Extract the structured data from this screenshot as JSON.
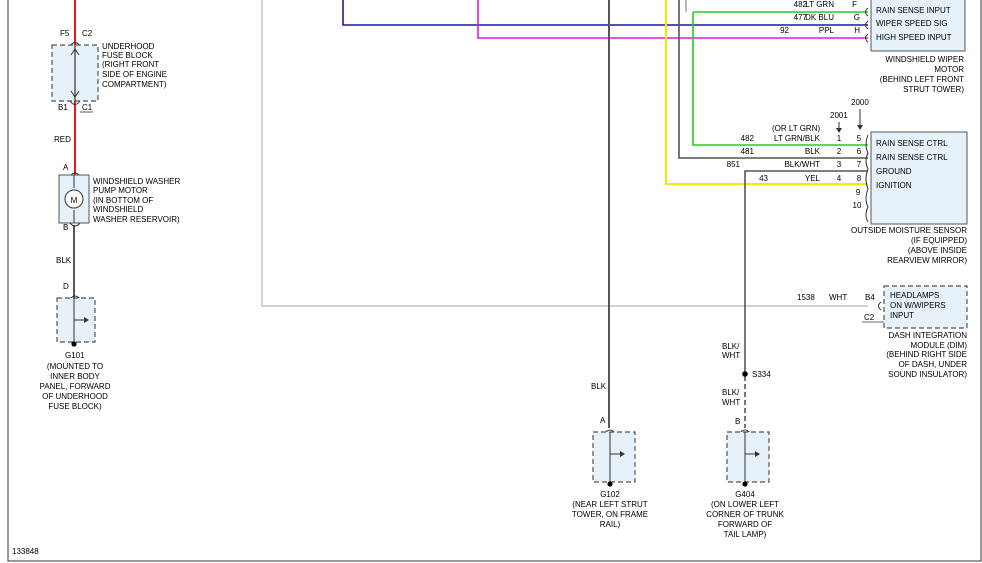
{
  "colors": {
    "red": "#e01a1a",
    "blk": "#555555",
    "ltgrn": "#8a8a8a",
    "dkblu": "#1a1a99",
    "ppl": "#e01ad0",
    "grn": "#22cc22",
    "yel": "#eded00",
    "tan": "#b8b8b8",
    "box_fill": "#e6f1fa"
  },
  "fuse_block": {
    "f5": "F5",
    "c2": "C2",
    "b1": "B1",
    "c1": "C1",
    "label": [
      "UNDERHOOD",
      "FUSE BLOCK",
      "(RIGHT FRONT",
      "SIDE OF ENGINE",
      "COMPARTMENT)"
    ]
  },
  "wire_red": "RED",
  "washer_motor": {
    "pin_a": "A",
    "pin_b": "B",
    "symbol": "M",
    "label": [
      "WINDSHIELD WASHER",
      "PUMP MOTOR",
      "(IN BOTTOM OF",
      "WINDSHIELD",
      "WASHER RESERVOIR)"
    ]
  },
  "wire_blk_left": "BLK",
  "g101": {
    "pin": "D",
    "name": "G101",
    "label": [
      "(MOUNTED TO",
      "INNER BODY",
      "PANEL, FORWARD",
      "OF UNDERHOOD",
      "FUSE BLOCK)"
    ]
  },
  "wiper_motor": {
    "rows": [
      {
        "circuit": "482",
        "color": "LT GRN",
        "pin": "F",
        "func": "RAIN SENSE INPUT"
      },
      {
        "circuit": "477",
        "color": "DK BLU",
        "pin": "G",
        "func": "WIPER SPEED SIG"
      },
      {
        "circuit": "92",
        "color": "PPL",
        "pin": "H",
        "func": "HIGH SPEED INPUT"
      }
    ],
    "label": [
      "WINDSHIELD WIPER",
      "MOTOR",
      "(BEHIND LEFT FRONT",
      "STRUT TOWER)"
    ]
  },
  "moisture_sensor": {
    "conn_2000": "2000",
    "conn_2001": "2001",
    "alt_color": "(OR LT GRN)",
    "rows": [
      {
        "circuit": "482",
        "color": "LT GRN/BLK",
        "pin_a": "1",
        "pin_b": "5",
        "func": "RAIN SENSE CTRL"
      },
      {
        "circuit": "481",
        "color": "BLK",
        "pin_a": "2",
        "pin_b": "6",
        "func": "RAIN SENSE CTRL"
      },
      {
        "circuit": "851",
        "color": "BLK/WHT",
        "pin_a": "3",
        "pin_b": "7",
        "func": "GROUND"
      },
      {
        "circuit": "43",
        "color": "YEL",
        "pin_a": "4",
        "pin_b": "8",
        "func": "IGNITION"
      }
    ],
    "extra_pins": [
      "9",
      "10"
    ],
    "label": [
      "OUTSIDE MOISTURE SENSOR",
      "(IF EQUIPPED)",
      "(ABOVE INSIDE",
      "REARVIEW MIRROR)"
    ]
  },
  "dim": {
    "circuit": "1538",
    "color": "WHT",
    "pin_b4": "B4",
    "pin_c2": "C2",
    "func": [
      "HEADLAMPS",
      "ON W/WIPERS",
      "INPUT"
    ],
    "label": [
      "DASH INTEGRATION",
      "MODULE (DIM)",
      "(BEHIND RIGHT SIDE",
      "OF DASH, UNDER",
      "SOUND INSULATOR)"
    ]
  },
  "wire_blk_center": "BLK",
  "g102": {
    "pin": "A",
    "name": "G102",
    "label": [
      "(NEAR LEFT STRUT",
      "TOWER, ON FRAME",
      "RAIL)"
    ]
  },
  "splice": {
    "name": "S334",
    "wire_top": [
      "BLK/",
      "WHT"
    ],
    "wire_bottom": [
      "BLK/",
      "WHT"
    ]
  },
  "g404": {
    "pin": "B",
    "name": "G404",
    "label": [
      "(ON LOWER LEFT",
      "CORNER OF TRUNK",
      "FORWARD OF",
      "TAIL LAMP)"
    ]
  },
  "figure_id": "133848"
}
